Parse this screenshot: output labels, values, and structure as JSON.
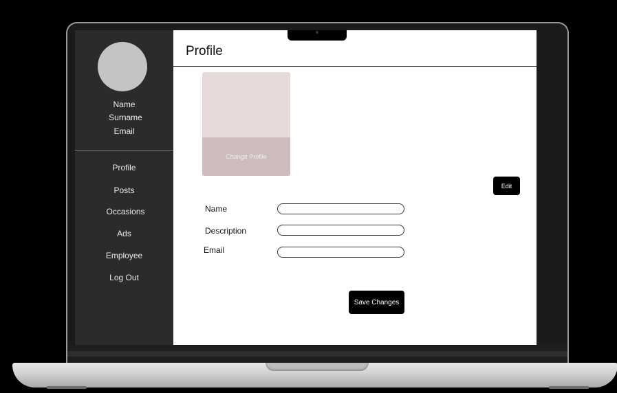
{
  "sidebar": {
    "user": {
      "name": "Name",
      "surname": "Surname",
      "email": "Email"
    },
    "items": [
      {
        "label": "Profile"
      },
      {
        "label": "Posts"
      },
      {
        "label": "Occasions"
      },
      {
        "label": "Ads"
      },
      {
        "label": "Employee"
      },
      {
        "label": "Log Out"
      }
    ]
  },
  "main": {
    "title": "Profile",
    "change_profile_label": "Change Profile",
    "edit_label": "Edit",
    "fields": [
      {
        "label": "Name",
        "value": ""
      },
      {
        "label": "Description",
        "value": ""
      },
      {
        "label": "Email",
        "value": ""
      }
    ],
    "save_label": "Save Changes"
  },
  "colors": {
    "sidebar_bg": "#2b2b2b",
    "avatar": "#c4c4c4",
    "photo_bg": "#e5dad9",
    "photo_button": "#cdbcbc",
    "button_bg": "#000000"
  }
}
